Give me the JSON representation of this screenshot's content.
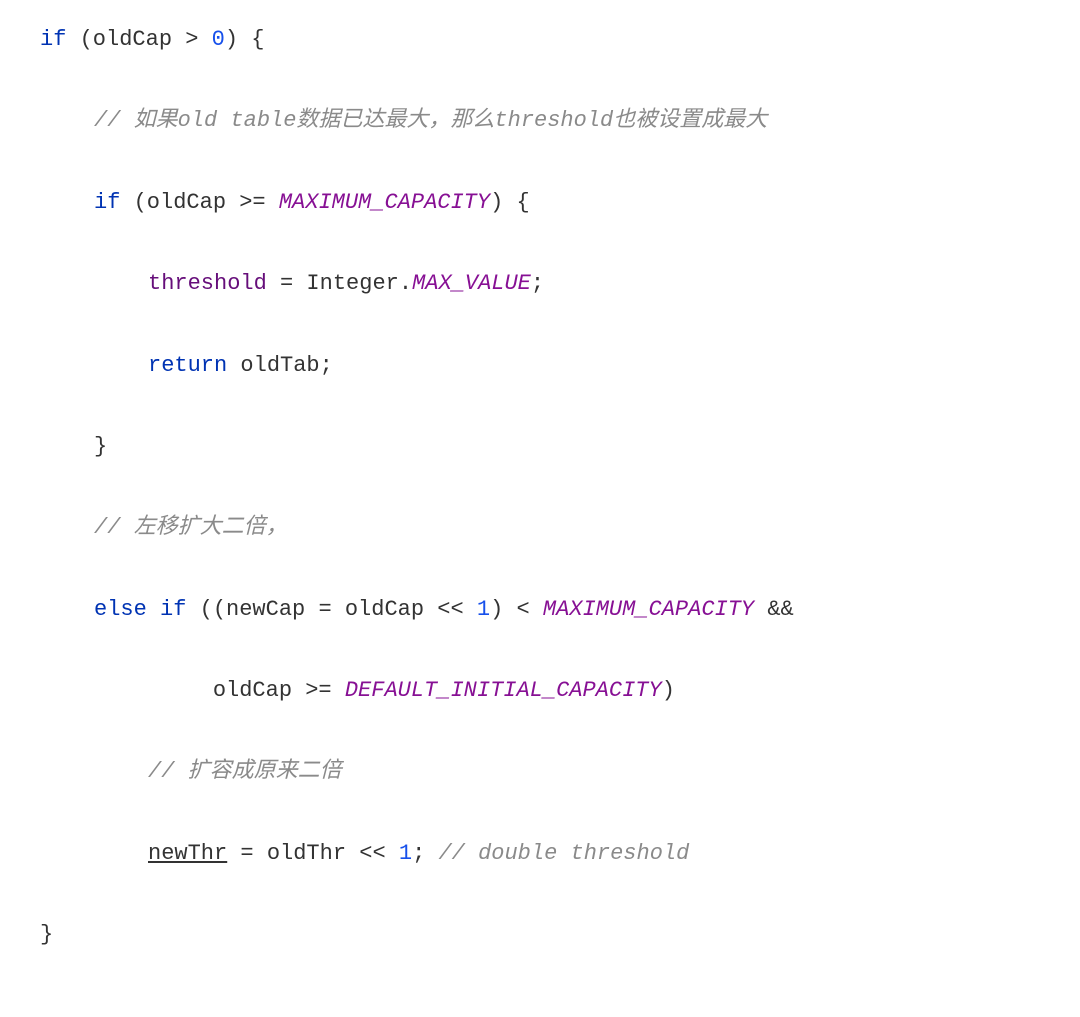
{
  "code": {
    "line1": {
      "kw_if": "if",
      "open": " (oldCap > ",
      "num": "0",
      "close": ") {"
    },
    "line2": {
      "comment": "// 如果old table数据已达最大，那么threshold也被设置成最大"
    },
    "line3": {
      "kw_if": "if",
      "open": " (oldCap >= ",
      "const": "MAXIMUM_CAPACITY",
      "close": ") {"
    },
    "line4": {
      "var": "threshold",
      "eq": " = Integer.",
      "const": "MAX_VALUE",
      "semi": ";"
    },
    "line5": {
      "kw_return": "return",
      "rest": " oldTab;"
    },
    "line6": {
      "brace": "}"
    },
    "line7": {
      "comment": "// 左移扩大二倍，"
    },
    "line8": {
      "kw_else": "else if",
      "open": " ((newCap = oldCap << ",
      "num1": "1",
      "mid": ") < ",
      "const": "MAXIMUM_CAPACITY",
      "and": " &&"
    },
    "line9": {
      "lead": "         oldCap >= ",
      "const": "DEFAULT_INITIAL_CAPACITY",
      "close": ")"
    },
    "line10": {
      "comment": "// 扩容成原来二倍"
    },
    "line11": {
      "var": "newThr",
      "eq": " = oldThr << ",
      "num": "1",
      "semi": "; ",
      "comment": "// double threshold"
    },
    "line12": {
      "brace": "}"
    }
  }
}
